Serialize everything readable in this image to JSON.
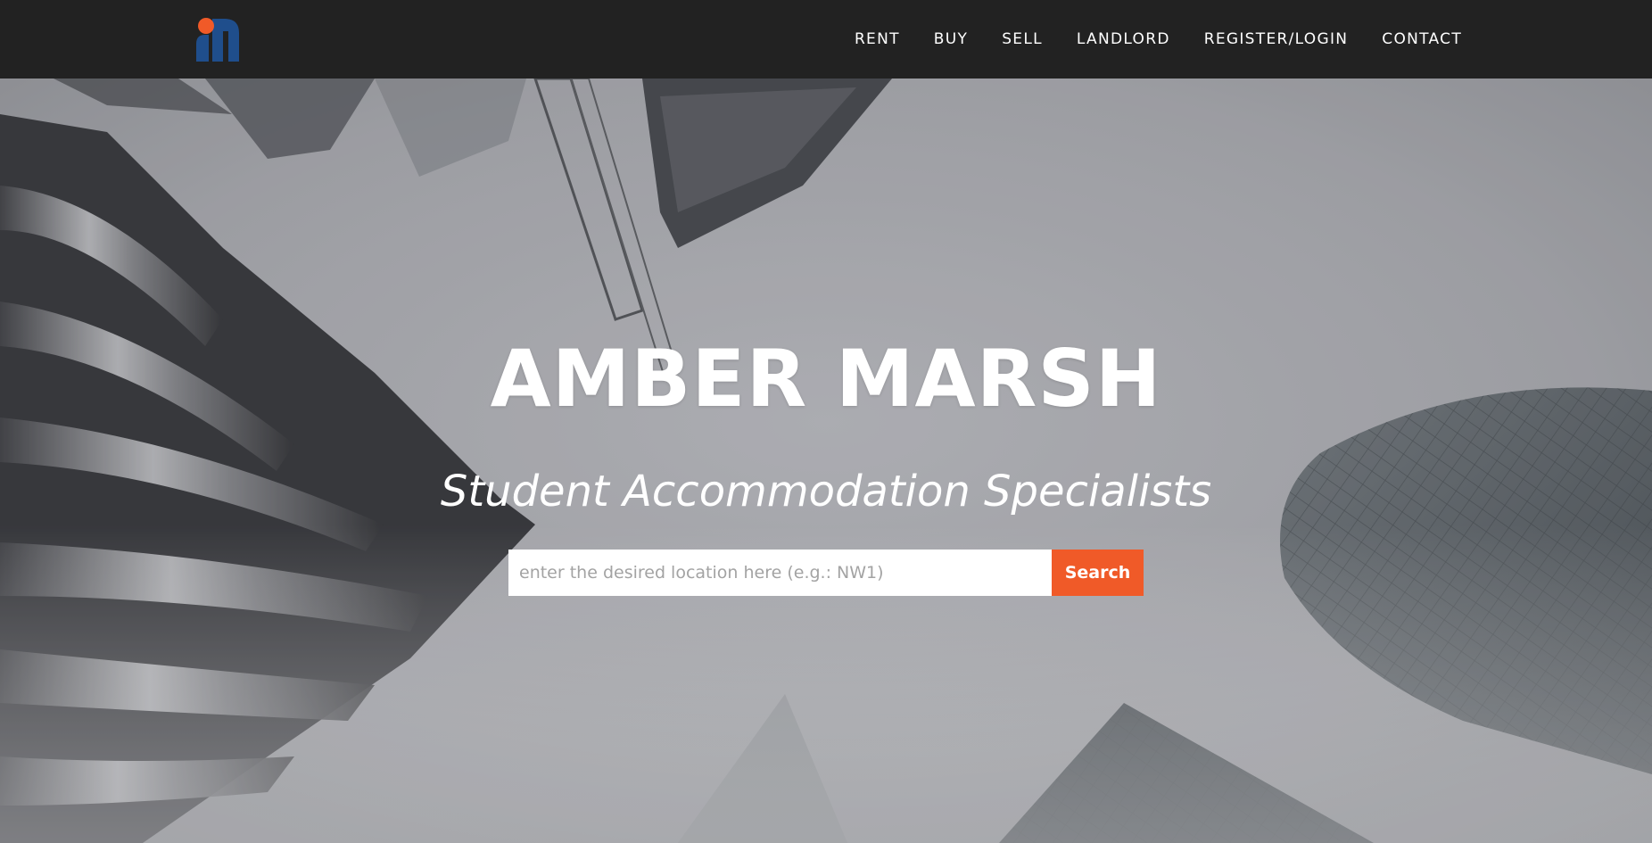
{
  "nav": {
    "logo": {
      "icon": "amber-marsh-logo-icon",
      "dot_color": "#f05a28",
      "body_color": "#1f4e8c"
    },
    "links": [
      {
        "label": "RENT"
      },
      {
        "label": "BUY"
      },
      {
        "label": "SELL"
      },
      {
        "label": "LANDLORD"
      },
      {
        "label": "REGISTER/LOGIN"
      },
      {
        "label": "CONTACT"
      }
    ]
  },
  "hero": {
    "title": "AMBER MARSH",
    "subtitle": "Student Accommodation Specialists",
    "search": {
      "placeholder": "enter the desired location here (e.g.: NW1)",
      "value": "",
      "button_label": "Search"
    }
  },
  "colors": {
    "navbar_bg": "#222222",
    "accent": "#f05a28",
    "text_light": "#ffffff"
  }
}
